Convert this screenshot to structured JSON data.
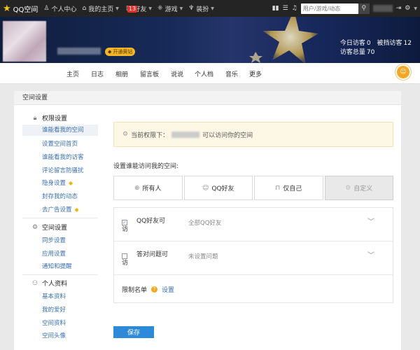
{
  "topbar": {
    "logo_text": "QQ空间",
    "personal_center": "个人中心",
    "my_home": "我的主页",
    "friends_count": "13",
    "friends": "好友",
    "games": "游戏",
    "decorate": "装扮",
    "search_placeholder": "用户/游戏/动态"
  },
  "banner": {
    "vip_label": "开通黄钻",
    "today_visitors_label": "今日访客",
    "today_visitors": "0",
    "blocked_label": "被挡访客",
    "blocked": "12",
    "total_label": "访客总量",
    "total": "70"
  },
  "nav": {
    "items": [
      "主页",
      "日志",
      "相册",
      "留言板",
      "说说",
      "个人档",
      "音乐",
      "更多"
    ]
  },
  "panel": {
    "title": "空间设置"
  },
  "sidebar": {
    "groups": [
      {
        "title": "权限设置",
        "items": [
          "谁能看我的空间",
          "设置空间首页",
          "谁能看我的访客",
          "评论留言防骚扰",
          "隐身设置",
          "封存我的动态",
          "去广告设置"
        ]
      },
      {
        "title": "空间设置",
        "items": [
          "同步设置",
          "应用设置",
          "通知和提醒"
        ]
      },
      {
        "title": "个人资料",
        "items": [
          "基本资料",
          "我的爱好",
          "空间资料",
          "空间头像"
        ]
      }
    ]
  },
  "content": {
    "notice_prefix": "当前权限下：",
    "notice_suffix": "可以访问你的空间",
    "access_label": "设置谁能访问我的空间:",
    "options": [
      "所有人",
      "QQ好友",
      "仅自己",
      "自定义"
    ],
    "selected_option": "自定义",
    "qq_friends_label_1": "QQ好友可",
    "qq_friends_label_2": "访",
    "qq_friends_value": "全部QQ好友",
    "answer_label_1": "答对问题可",
    "answer_label_2": "访",
    "answer_value": "未设置问题",
    "restrict_label": "限制名单",
    "restrict_link": "设置",
    "save_label": "保存"
  },
  "colors": {
    "accent": "#2d8ad9",
    "link": "#3a6fb0",
    "topbar_bg": "#242424"
  }
}
